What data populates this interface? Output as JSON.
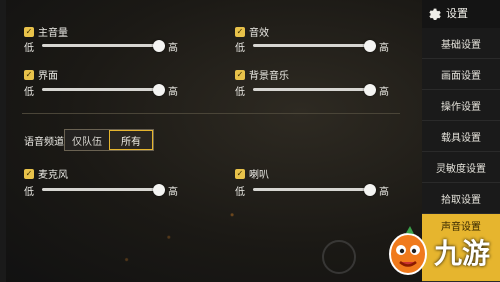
{
  "audio": {
    "master": {
      "label": "主音量",
      "min": "低",
      "max": "高",
      "value": 1.0
    },
    "sfx": {
      "label": "音效",
      "min": "低",
      "max": "高",
      "value": 1.0
    },
    "ui": {
      "label": "界面",
      "min": "低",
      "max": "高",
      "value": 1.0
    },
    "bgm": {
      "label": "背景音乐",
      "min": "低",
      "max": "高",
      "value": 1.0
    },
    "mic": {
      "label": "麦克风",
      "min": "低",
      "max": "高",
      "value": 1.0
    },
    "speaker": {
      "label": "喇叭",
      "min": "低",
      "max": "高",
      "value": 1.0
    }
  },
  "voice_channel": {
    "label": "语音频道",
    "options": [
      "仅队伍",
      "所有"
    ],
    "selected": "所有"
  },
  "sidebar": {
    "title": "设置",
    "items": [
      {
        "label": "基础设置"
      },
      {
        "label": "画面设置"
      },
      {
        "label": "操作设置"
      },
      {
        "label": "载具设置"
      },
      {
        "label": "灵敏度设置"
      },
      {
        "label": "拾取设置"
      },
      {
        "label": "声音设置"
      }
    ]
  },
  "watermark": {
    "text": "九游"
  },
  "colors": {
    "accent": "#e6b52e",
    "check": "#e8c24a"
  }
}
